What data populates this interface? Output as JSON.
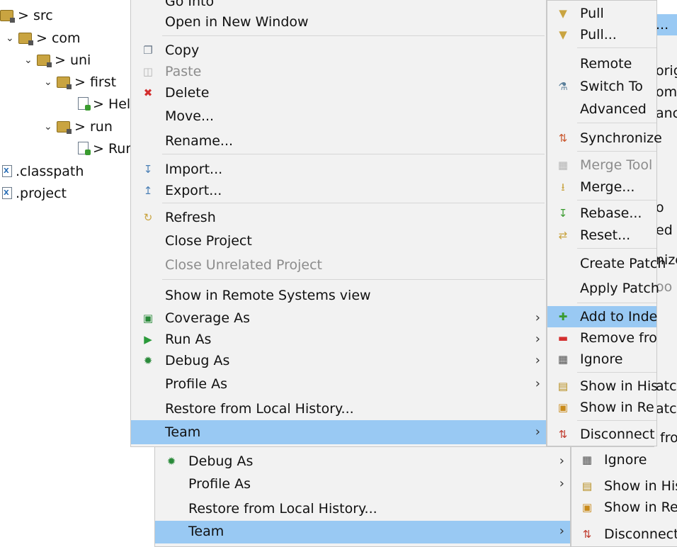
{
  "tree": [
    {
      "label": "> src",
      "kind": "pkg"
    },
    {
      "label": "> com",
      "kind": "pkg"
    },
    {
      "label": "> uni",
      "kind": "pkg"
    },
    {
      "label": "> first",
      "kind": "pkg"
    },
    {
      "label": "> Hel",
      "kind": "java"
    },
    {
      "label": "> run",
      "kind": "pkg"
    },
    {
      "label": "> Rur",
      "kind": "java"
    },
    {
      "label": ".classpath",
      "kind": "xml"
    },
    {
      "label": ".project",
      "kind": "xml"
    }
  ],
  "main_menu": {
    "go_into": "Go Into",
    "open_new_window": "Open in New Window",
    "copy": "Copy",
    "paste": "Paste",
    "delete": "Delete",
    "move": "Move...",
    "rename": "Rename...",
    "import": "Import...",
    "export": "Export...",
    "refresh": "Refresh",
    "close_project": "Close Project",
    "close_unrelated": "Close Unrelated Project",
    "show_remote": "Show in Remote Systems view",
    "coverage_as": "Coverage As",
    "run_as": "Run As",
    "debug_as": "Debug As",
    "profile_as": "Profile As",
    "restore_history": "Restore from Local History...",
    "team": "Team"
  },
  "ghost_menu": {
    "debug_as": "Debug As",
    "profile_as": "Profile As",
    "restore_history": "Restore from Local History...",
    "team": "Team"
  },
  "team_menu": {
    "pull": "Pull",
    "pull_dots": "Pull...",
    "remote": "Remote",
    "switch_to": "Switch To",
    "advanced": "Advanced",
    "synchronize": "Synchronize",
    "merge_tool": "Merge Tool",
    "merge": "Merge...",
    "rebase": "Rebase...",
    "reset": "Reset...",
    "create_patch": "Create Patch",
    "apply_patch": "Apply Patch",
    "add_to_index": "Add to Inde",
    "remove_from": "Remove fro",
    "ignore": "Ignore",
    "show_history": "Show in His",
    "show_repo": "Show in Re",
    "disconnect": "Disconnect"
  },
  "team_ghost": {
    "ignore": "Ignore",
    "show_history": "Show in His",
    "show_repo": "Show in Re",
    "disconnect": "Disconnect"
  },
  "right_fragments": {
    "dots": "...",
    "f1": "orig",
    "f2": "om",
    "f3": "anch",
    "f4": "o",
    "f5": "ed",
    "f6": "nize",
    "f7": "oo",
    "f8": "atc",
    "f9": "atch",
    "f10": "fro"
  },
  "colors": {
    "highlight": "#99c9f3",
    "menu_bg": "#f2f2f2",
    "disabled": "#8c8c8c"
  }
}
